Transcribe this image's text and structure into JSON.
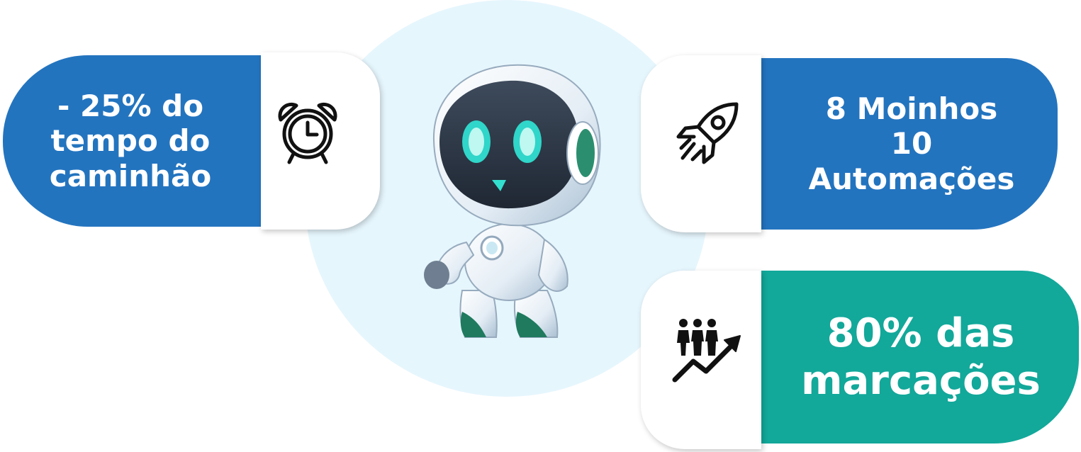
{
  "stats": [
    {
      "text": "- 25% do\ntempo do\ncaminhão",
      "icon": "alarm-clock-icon"
    },
    {
      "text": "8 Moinhos\n10\nAutomações",
      "icon": "rocket-icon"
    },
    {
      "text": "80% das\nmarcações",
      "icon": "people-growth-icon"
    }
  ],
  "colors": {
    "blue": "#2374bf",
    "teal": "#12a89a",
    "circle": "#e6f6fd"
  },
  "illustration": "robot-mascot"
}
